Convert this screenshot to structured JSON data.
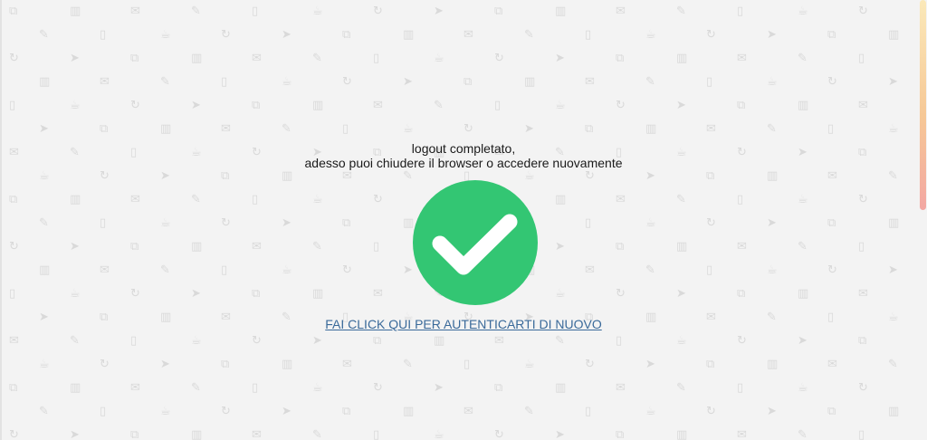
{
  "message": {
    "line1": "logout completato,",
    "line2": "adesso puoi chiudere il browser o accedere nuovamente"
  },
  "status_icon": {
    "name": "checkmark-icon",
    "color": "#33c673",
    "check_color": "#ffffff"
  },
  "relogin_link": {
    "label": "FAI CLICK QUI PER AUTENTICARTI DI NUOVO",
    "color": "#3a6a9a"
  },
  "background": {
    "color": "#f3f3f3",
    "pattern_color": "#d9d9d9",
    "pattern_icons": [
      "link-icon",
      "phone-icon",
      "envelope-icon",
      "pencil-icon",
      "tablet-icon",
      "coffee-cup-icon",
      "refresh-icon",
      "paper-plane-icon"
    ]
  },
  "scrollbar": {
    "gradient_colors": [
      "#fbe9b9",
      "#f6c896",
      "#f3a7a3"
    ]
  }
}
